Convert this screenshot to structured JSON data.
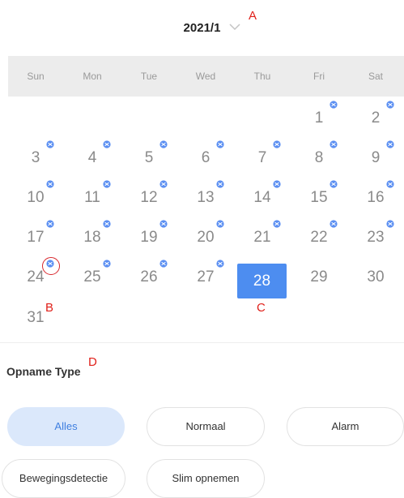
{
  "header": {
    "month_label": "2021/1"
  },
  "annotations": {
    "a": "A",
    "b": "B",
    "c": "C",
    "d": "D"
  },
  "weekdays": [
    "Sun",
    "Mon",
    "Tue",
    "Wed",
    "Thu",
    "Fri",
    "Sat"
  ],
  "calendar": {
    "selected_day": "28",
    "days": [
      "1",
      "2",
      "3",
      "4",
      "5",
      "6",
      "7",
      "8",
      "9",
      "10",
      "11",
      "12",
      "13",
      "14",
      "15",
      "16",
      "17",
      "18",
      "19",
      "20",
      "21",
      "22",
      "23",
      "24",
      "25",
      "26",
      "27",
      "28",
      "29",
      "30",
      "31"
    ],
    "recorded_days": [
      "1",
      "2",
      "3",
      "4",
      "5",
      "6",
      "7",
      "8",
      "9",
      "10",
      "11",
      "12",
      "13",
      "14",
      "15",
      "16",
      "17",
      "18",
      "19",
      "20",
      "21",
      "22",
      "23",
      "24",
      "25",
      "26",
      "27"
    ]
  },
  "recording_type": {
    "title": "Opname Type",
    "options": [
      "Alles",
      "Normaal",
      "Alarm",
      "Bewegingsdetectie",
      "Slim opnemen"
    ],
    "selected": "Alles"
  },
  "colors": {
    "accent": "#4d8df0",
    "dot": "#5b8ff2",
    "annotation": "#e0201a"
  }
}
